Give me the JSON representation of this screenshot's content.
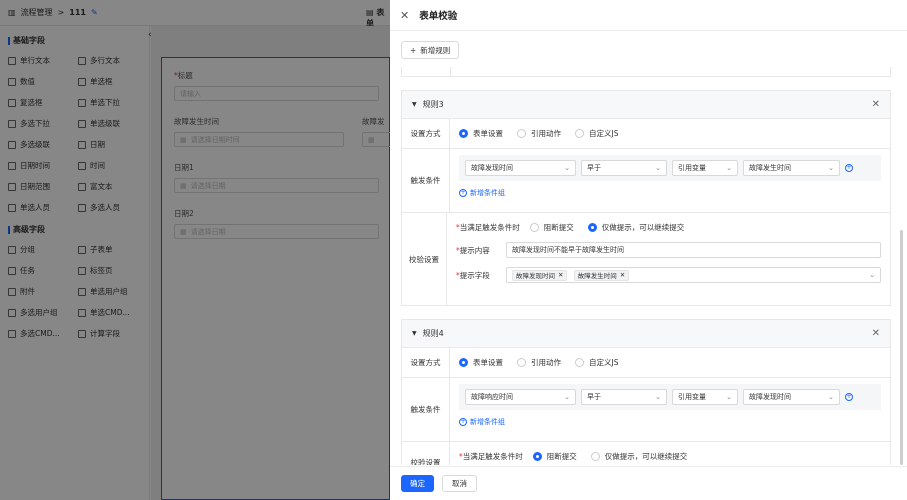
{
  "topbar": {
    "app": "流程管理",
    "sep": ">",
    "process": "111",
    "tab": "表单"
  },
  "left": {
    "basic_title": "基础字段",
    "basic_fields": [
      {
        "label": "单行文本",
        "icon": "text-icon"
      },
      {
        "label": "多行文本",
        "icon": "textarea-icon"
      },
      {
        "label": "数值",
        "icon": "number-icon"
      },
      {
        "label": "单选框",
        "icon": "radio-icon"
      },
      {
        "label": "复选框",
        "icon": "checkbox-icon"
      },
      {
        "label": "单选下拉",
        "icon": "select-icon"
      },
      {
        "label": "多选下拉",
        "icon": "multi-select-icon"
      },
      {
        "label": "单选级联",
        "icon": "cascader-icon"
      },
      {
        "label": "多选级联",
        "icon": "multi-cascader-icon"
      },
      {
        "label": "日期",
        "icon": "date-icon"
      },
      {
        "label": "日期时间",
        "icon": "datetime-icon"
      },
      {
        "label": "时间",
        "icon": "time-icon"
      },
      {
        "label": "日期范围",
        "icon": "date-range-icon"
      },
      {
        "label": "富文本",
        "icon": "rich-text-icon"
      },
      {
        "label": "单选人员",
        "icon": "user-icon"
      },
      {
        "label": "多选人员",
        "icon": "users-icon"
      }
    ],
    "advanced_title": "高级字段",
    "advanced_fields": [
      {
        "label": "分组",
        "icon": "group-icon"
      },
      {
        "label": "子表单",
        "icon": "subform-icon"
      },
      {
        "label": "任务",
        "icon": "task-icon"
      },
      {
        "label": "标签页",
        "icon": "tabs-icon"
      },
      {
        "label": "附件",
        "icon": "attachment-icon"
      },
      {
        "label": "单选用户组",
        "icon": "user-group-icon"
      },
      {
        "label": "多选用户组",
        "icon": "multi-user-group-icon"
      },
      {
        "label": "单选CMD...",
        "icon": "cmdb-icon"
      },
      {
        "label": "多选CMD...",
        "icon": "multi-cmdb-icon"
      },
      {
        "label": "计算字段",
        "icon": "calc-icon"
      }
    ]
  },
  "form": {
    "title_label": "标题",
    "title_placeholder": "请输入",
    "fault_time_label": "故障发生时间",
    "fault_time_placeholder": "请选择日期时间",
    "cut_label": "故障发",
    "date1_label": "日期1",
    "date1_placeholder": "请选择日期",
    "date2_label": "日期2",
    "date2_placeholder": "请选择日期"
  },
  "drawer": {
    "title": "表单校验",
    "add_rule": "新增规则",
    "rule3": {
      "title": "规则3",
      "setting_label": "设置方式",
      "modes": [
        "表单设置",
        "引用动作",
        "自定义JS"
      ],
      "trigger_label": "触发条件",
      "conditions": [
        "故障发现时间",
        "早于",
        "引用变量",
        "故障发生时间"
      ],
      "add_condition_group": "新增条件组",
      "validate_label": "校验设置",
      "when_label": "当满足触发条件时",
      "options": [
        "阻断提交",
        "仅做提示，可以继续提交"
      ],
      "tip_label": "提示内容",
      "tip_value": "故障发现时间不能早于故障发生时间",
      "field_label": "提示字段",
      "tags": [
        "故障发现时间",
        "故障发生时间"
      ]
    },
    "rule4": {
      "title": "规则4",
      "setting_label": "设置方式",
      "modes": [
        "表单设置",
        "引用动作",
        "自定义JS"
      ],
      "trigger_label": "触发条件",
      "conditions": [
        "故障响应时间",
        "早于",
        "引用变量",
        "故障发现时间"
      ],
      "add_condition_group": "新增条件组",
      "validate_label": "校验设置",
      "when_label": "当满足触发条件时",
      "options": [
        "阻断提交",
        "仅做提示，可以继续提交"
      ]
    },
    "confirm": "确定",
    "cancel": "取消"
  }
}
